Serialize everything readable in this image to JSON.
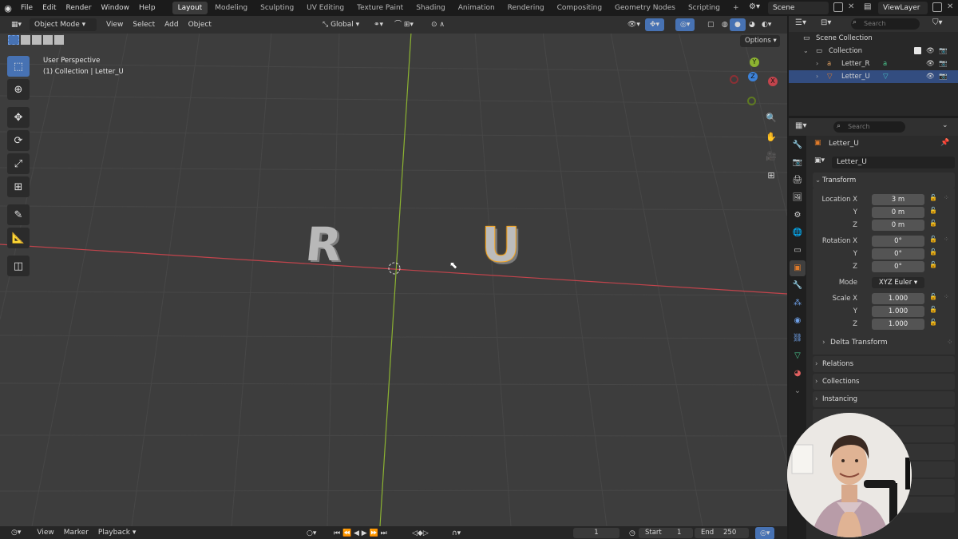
{
  "topbar": {
    "menus": [
      "File",
      "Edit",
      "Render",
      "Window",
      "Help"
    ],
    "workspaces": [
      "Layout",
      "Modeling",
      "Sculpting",
      "UV Editing",
      "Texture Paint",
      "Shading",
      "Animation",
      "Rendering",
      "Compositing",
      "Geometry Nodes",
      "Scripting"
    ],
    "add_tab": "+",
    "scene": "Scene",
    "view_layer": "ViewLayer"
  },
  "viewport": {
    "mode": "Object Mode",
    "menus": [
      "View",
      "Select",
      "Add",
      "Object"
    ],
    "orientation": "Global",
    "options": "Options",
    "info_line1": "User Perspective",
    "info_line2": "(1) Collection | Letter_U",
    "objects": {
      "letter_r": "R",
      "letter_u": "U"
    },
    "gizmo": {
      "y": "Y",
      "x": "X",
      "z": "Z"
    },
    "colors": {
      "x_axis": "#c2444c",
      "y_axis": "#8cb331",
      "z_axis": "#3d82d8",
      "selected_outline": "#f5a623",
      "background": "#3d3d3d"
    }
  },
  "timeline": {
    "menus": [
      "View",
      "Marker",
      "Playback"
    ],
    "current_frame": "1",
    "start_label": "Start",
    "start": "1",
    "end_label": "End",
    "end": "250"
  },
  "outliner": {
    "search_placeholder": "Search",
    "scene_collection": "Scene Collection",
    "collection": "Collection",
    "items": [
      "Letter_R",
      "Letter_U"
    ],
    "selected": "Letter_U"
  },
  "properties": {
    "search_placeholder": "Search",
    "object_name": "Letter_U",
    "data_name": "Letter_U",
    "transform_label": "Transform",
    "location": {
      "label": "Location X",
      "y": "Y",
      "z": "Z",
      "vx": "3 m",
      "vy": "0 m",
      "vz": "0 m"
    },
    "rotation": {
      "label": "Rotation X",
      "y": "Y",
      "z": "Z",
      "vx": "0°",
      "vy": "0°",
      "vz": "0°"
    },
    "mode_label": "Mode",
    "mode_value": "XYZ Euler",
    "scale": {
      "label": "Scale X",
      "y": "Y",
      "z": "Z",
      "vx": "1.000",
      "vy": "1.000",
      "vz": "1.000"
    },
    "sections": [
      "Delta Transform",
      "Relations",
      "Collections",
      "Instancing"
    ],
    "accent": "#e07b2a"
  }
}
